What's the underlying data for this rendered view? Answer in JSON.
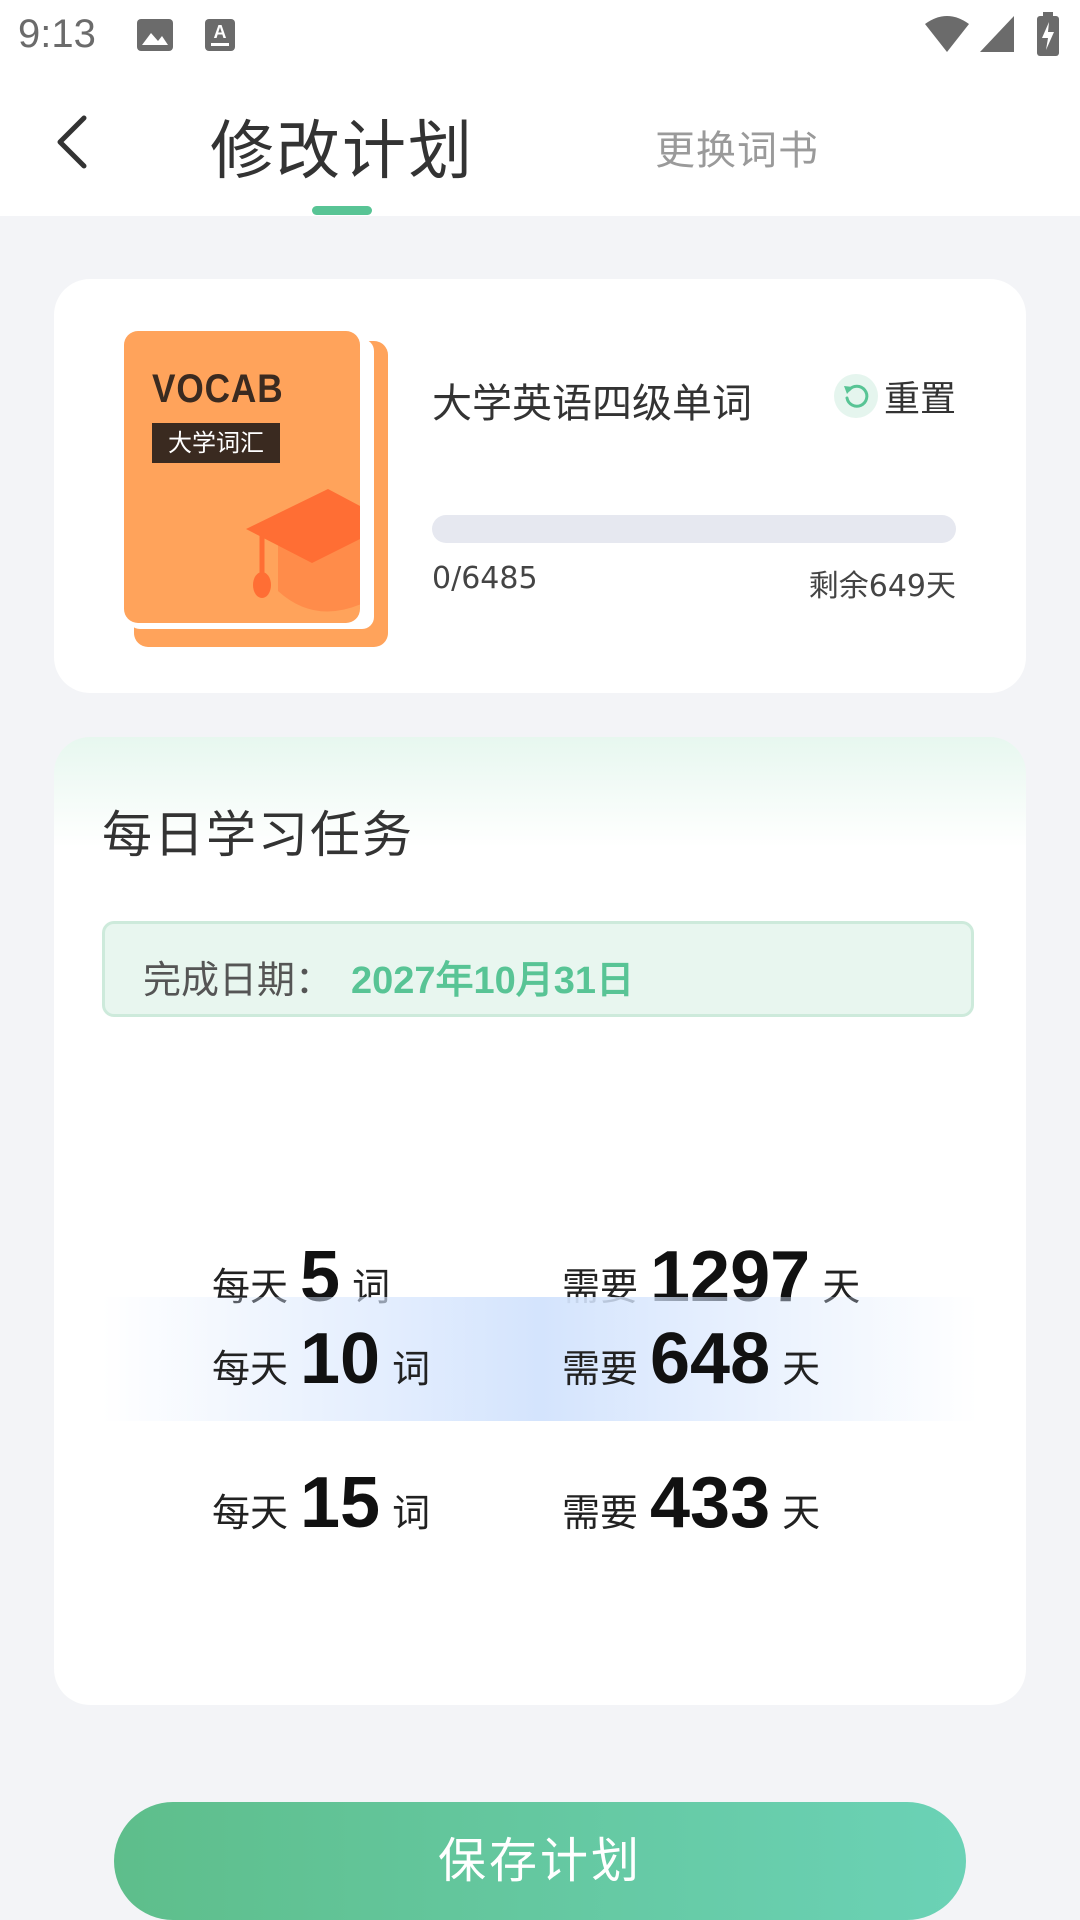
{
  "status_bar": {
    "time": "9:13",
    "icons": [
      "image-icon",
      "text-input-icon",
      "wifi-icon",
      "cellular-signal-icon",
      "battery-charging-icon"
    ]
  },
  "header": {
    "back_icon": "chevron-left-icon",
    "active_tab": "修改计划",
    "inactive_tab": "更换词书",
    "accent_color": "#58c495"
  },
  "book": {
    "cover_brand": "VOCAB",
    "cover_tag": "大学词汇",
    "cover_color": "#ffa35b",
    "title": "大学英语四级单词",
    "reset_label": "重置",
    "reset_icon": "refresh-icon",
    "progress_text": "0/6485",
    "progress_fraction": 0,
    "remaining_text": "剩余649天"
  },
  "daily_task": {
    "title": "每日学习任务",
    "finish_label": "完成日期：",
    "finish_date": "2027年10月31日",
    "options": [
      {
        "per_day_prefix": "每天",
        "words": "5",
        "words_unit": "词",
        "need_prefix": "需要",
        "days": "1297",
        "days_unit": "天",
        "selected": false
      },
      {
        "per_day_prefix": "每天",
        "words": "10",
        "words_unit": "词",
        "need_prefix": "需要",
        "days": "648",
        "days_unit": "天",
        "selected": true
      },
      {
        "per_day_prefix": "每天",
        "words": "15",
        "words_unit": "词",
        "need_prefix": "需要",
        "days": "433",
        "days_unit": "天",
        "selected": false
      }
    ]
  },
  "save_button": {
    "label": "保存计划"
  }
}
